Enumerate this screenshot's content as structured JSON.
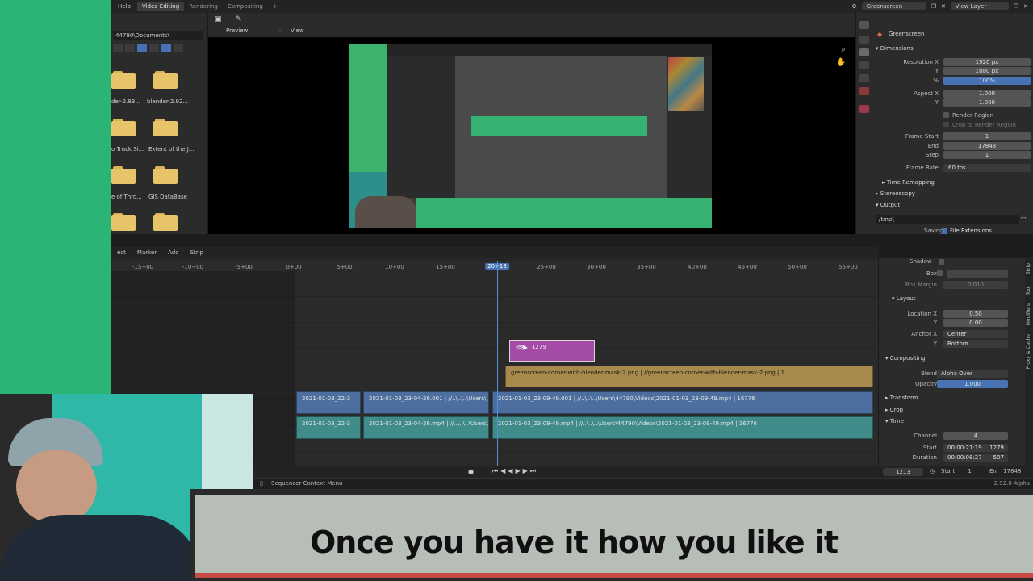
{
  "topbar": {
    "menu_help": "Help",
    "tabs": [
      "Video Editing",
      "Rendering",
      "Compositing",
      "+"
    ],
    "scene": "Greenscreen",
    "view_layer": "View Layer"
  },
  "filebrowser": {
    "path": "44790\\Documents\\",
    "folders": [
      "der-2.83...",
      "blender-2.92...",
      "o Truck Si...",
      "Extent of the J...",
      "e of Thro...",
      "GIS DataBase"
    ]
  },
  "preview": {
    "mode": "Preview",
    "view_menu": "View"
  },
  "properties": {
    "scene_name": "Greenscreen",
    "dimensions_label": "Dimensions",
    "res_x_label": "Resolution X",
    "res_x": "1920 px",
    "res_y_label": "Y",
    "res_y": "1080 px",
    "res_pct_label": "%",
    "res_pct": "100%",
    "aspect_x_label": "Aspect X",
    "aspect_x": "1.000",
    "aspect_y_label": "Y",
    "aspect_y": "1.000",
    "render_region": "Render Region",
    "crop_region": "Crop to Render Region",
    "frame_start_label": "Frame Start",
    "frame_start": "1",
    "end_label": "End",
    "end": "17848",
    "step_label": "Step",
    "step": "1",
    "frame_rate_label": "Frame Rate",
    "frame_rate": "60 fps",
    "time_remapping": "Time Remapping",
    "stereoscopy": "Stereoscopy",
    "output": "Output",
    "output_path": "/tmp\\",
    "saving_label": "Saving",
    "file_extensions": "File Extensions"
  },
  "timeline": {
    "menus": [
      "ect",
      "Marker",
      "Add",
      "Strip"
    ],
    "ticks": [
      "-15+00",
      "-10+00",
      "-5+00",
      "0+00",
      "5+00",
      "10+00",
      "15+00",
      "25+00",
      "30+00",
      "35+00",
      "40+00",
      "45+00",
      "50+00",
      "55+00"
    ],
    "playhead": "20+13",
    "strips": {
      "text": "Text | 1279",
      "image": "greenscreen-corner-with-blender-mask-2.png | //greenscreen-corner-with-blender-mask-2.png | 1",
      "movie_a": "2021-01-03_22-3",
      "movie_b": "2021-01-03_23-04-26.001 | //..\\..\\..\\Users\\",
      "movie_c": "2021-01-03_23-09-49.001 | //..\\..\\..\\Users\\44790\\Videos\\2021-01-03_23-09-49.mp4 | 16776",
      "sound_a": "2021-01-03_22-3",
      "sound_b": "2021-01-03_23-04-26.mp4 | //..\\..\\..\\Users\\",
      "sound_c": "2021-01-03_23-09-49.mp4 | //..\\..\\..\\Users\\44790\\Videos\\2021-01-03_23-09-49.mp4 | 16776"
    }
  },
  "sidebar": {
    "shadow": "Shadow",
    "box": "Box",
    "box_margin_label": "Box Margin",
    "box_margin": "0.010",
    "layout": "Layout",
    "loc_x_label": "Location X",
    "loc_x": "0.50",
    "loc_y_label": "Y",
    "loc_y": "0.00",
    "anchor_x_label": "Anchor X",
    "anchor_x": "Center",
    "anchor_y_label": "Y",
    "anchor_y": "Bottom",
    "compositing": "Compositing",
    "blend_label": "Blend",
    "blend": "Alpha Over",
    "opacity_label": "Opacity",
    "opacity": "1.000",
    "transform": "Transform",
    "crop": "Crop",
    "time": "Time",
    "channel_label": "Channel",
    "channel": "4",
    "start_label": "Start",
    "start_tc": "00:00:21:19",
    "start_frame": "1279",
    "duration_label": "Duration",
    "duration_tc": "00:00:08:27",
    "duration_frames": "507",
    "vtabs": [
      "Strip",
      "Tool",
      "Modifiers",
      "Proxy & Cache"
    ]
  },
  "playback": {
    "current_frame": "1213",
    "start_label": "Start",
    "start": "1",
    "end_label": "En",
    "end": "17848"
  },
  "status": {
    "context_menu": "Sequencer Context Menu",
    "version": "2.92.0 Alpha"
  },
  "caption": {
    "text": "Once you have it how you like it"
  }
}
